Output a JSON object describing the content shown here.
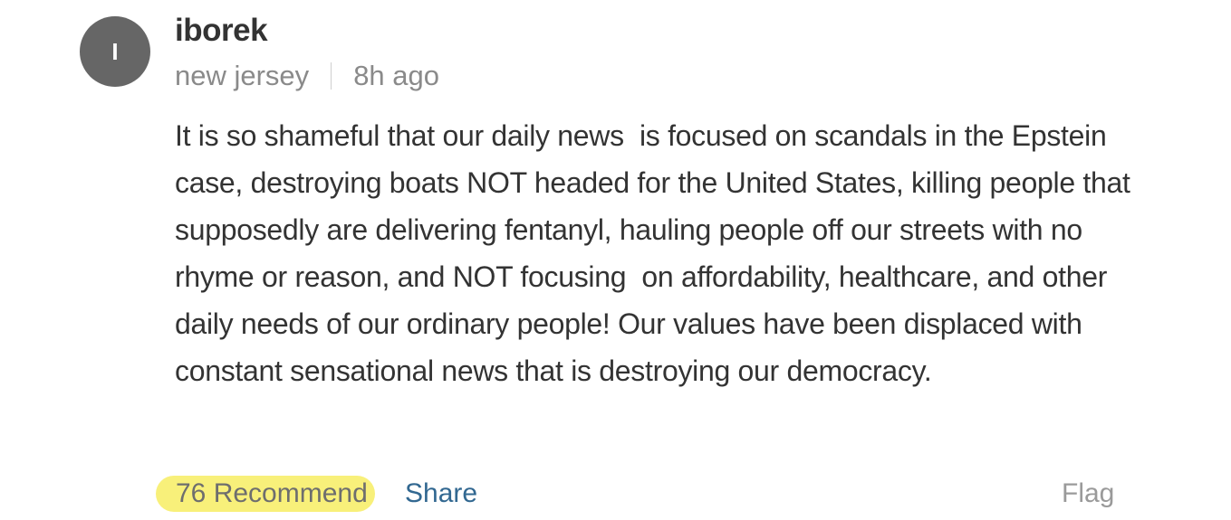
{
  "comment": {
    "avatar_initial": "I",
    "username": "iborek",
    "location": "new jersey",
    "timestamp": "8h ago",
    "body": "It is so shameful that our daily news  is focused on scandals in the Epstein case, destroying boats NOT headed for the United States, killing people that supposedly are delivering fentanyl, hauling people off our streets with no rhyme or reason, and NOT focusing  on affordability, healthcare, and other daily needs of our ordinary people! Our values have been displaced with constant sensational news that is destroying our democracy.",
    "actions": {
      "recommend_label": "76 Recommend",
      "share_label": "Share",
      "flag_label": "Flag"
    }
  },
  "colors": {
    "avatar_bg": "#666666",
    "recommend_highlight": "#f8f07a",
    "share_link": "#326891",
    "meta_text": "#8a8a8a"
  }
}
